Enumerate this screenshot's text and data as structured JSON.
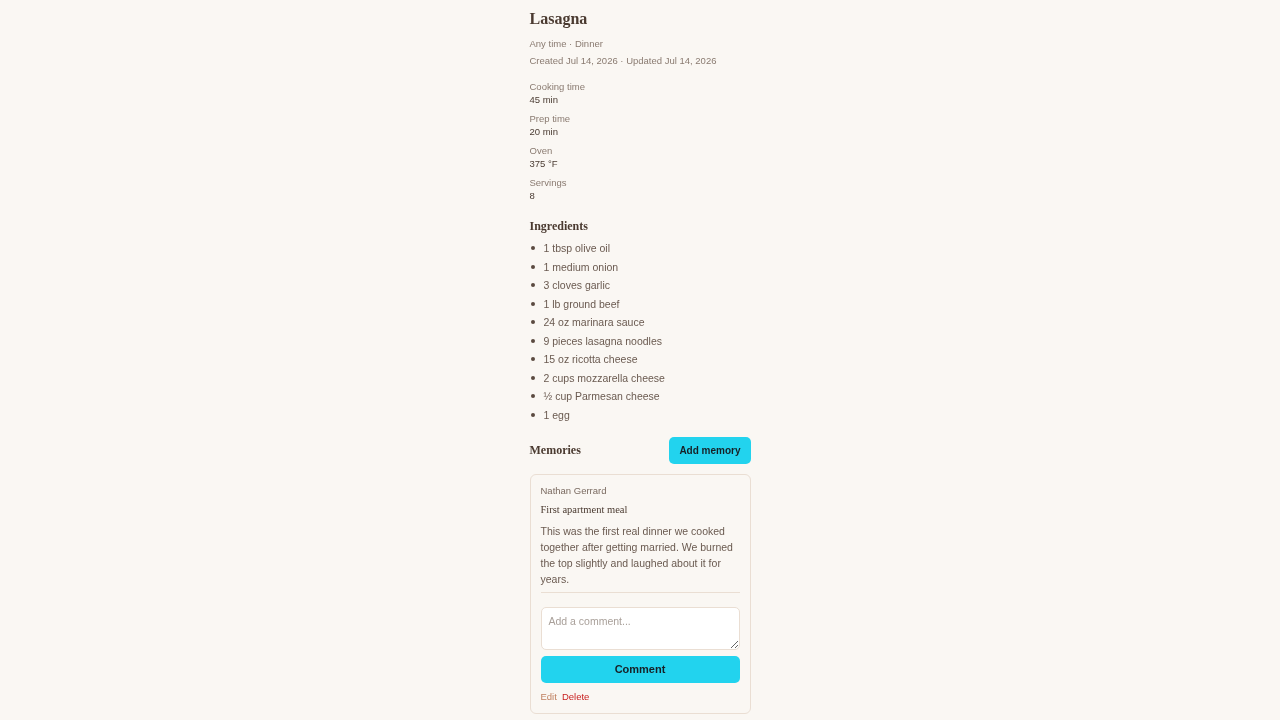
{
  "recipe": {
    "title": "Lasagna",
    "meta": "Any time · Dinner",
    "dates": "Created Jul 14, 2026 · Updated Jul 14, 2026"
  },
  "details": [
    {
      "label": "Cooking time",
      "value": "45 min"
    },
    {
      "label": "Prep time",
      "value": "20 min"
    },
    {
      "label": "Oven",
      "value": "375 °F"
    },
    {
      "label": "Servings",
      "value": "8"
    }
  ],
  "ingredients": {
    "heading": "Ingredients",
    "items": [
      "1 tbsp olive oil",
      "1 medium onion",
      "3 cloves garlic",
      "1 lb ground beef",
      "24 oz marinara sauce",
      "9 pieces lasagna noodles",
      "15 oz ricotta cheese",
      "2 cups mozzarella cheese",
      "½ cup Parmesan cheese",
      "1 egg"
    ]
  },
  "memories": {
    "heading": "Memories",
    "add_button": "Add memory",
    "entries": [
      {
        "author": "Nathan Gerrard",
        "title": "First apartment meal",
        "body": "This was the first real dinner we cooked together after getting married. We burned the top slightly and laughed about it for years.",
        "comment_field": {
          "placeholder": "Add a comment..."
        },
        "comment_button": "Comment",
        "actions": [
          {
            "label": "Edit",
            "kind": "edit"
          },
          {
            "label": "Delete",
            "kind": "delete"
          }
        ]
      }
    ]
  }
}
